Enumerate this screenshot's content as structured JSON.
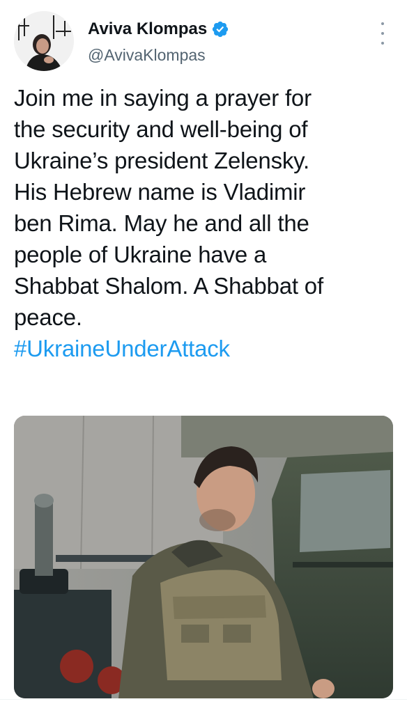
{
  "tweet": {
    "author_name": "Aviva Klompas",
    "author_handle": "@AvivaKlompas",
    "verified": true,
    "text_lines": [
      "Join me in saying a prayer for",
      "the security and well-being of",
      "Ukraine’s president Zelensky.",
      "His Hebrew name is Vladimir",
      "ben Rima. May he and all the",
      "people of Ukraine have a",
      "Shabbat Shalom. A Shabbat of",
      "peace."
    ],
    "hashtag": "#UkraineUnderAttack"
  },
  "icons": {
    "verified": "verified-badge-icon",
    "more": "more-options-icon"
  },
  "colors": {
    "link": "#1d9bf0",
    "text": "#0f1419",
    "secondary": "#536471",
    "verified": "#1d9bf0"
  }
}
